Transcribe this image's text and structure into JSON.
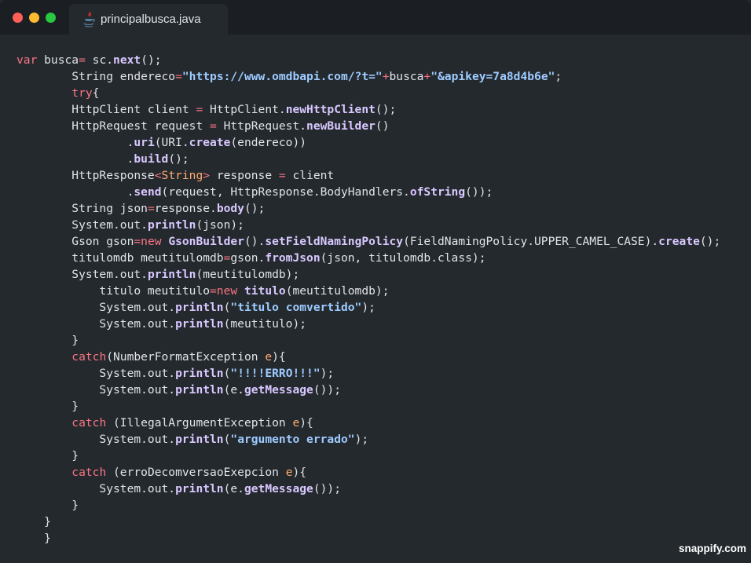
{
  "window": {
    "controls": [
      "close",
      "minimize",
      "maximize"
    ],
    "tab": {
      "title": "principalbusca.java",
      "icon": "java-file-icon"
    },
    "colors": {
      "background": "#24292e",
      "titlebar": "#1b1f23",
      "keyword": "#f97583",
      "method": "#d9c8ff",
      "string": "#9ecbff",
      "param": "#ffab70"
    }
  },
  "code": {
    "lines": [
      [
        [
          "k",
          "var"
        ],
        [
          "t",
          " busca"
        ],
        [
          "k",
          "="
        ],
        [
          "t",
          " sc."
        ],
        [
          "f",
          "next"
        ],
        [
          "t",
          "();"
        ]
      ],
      [
        [
          "t",
          "        String endereco"
        ],
        [
          "k",
          "="
        ],
        [
          "s",
          "\"https://www.omdbapi.com/?t=\""
        ],
        [
          "k",
          "+"
        ],
        [
          "t",
          "busca"
        ],
        [
          "k",
          "+"
        ],
        [
          "s",
          "\"&apikey=7a8d4b6e\""
        ],
        [
          "t",
          ";"
        ]
      ],
      [
        [
          "t",
          "        "
        ],
        [
          "k",
          "try"
        ],
        [
          "t",
          "{"
        ]
      ],
      [
        [
          "t",
          "        HttpClient client "
        ],
        [
          "k",
          "="
        ],
        [
          "t",
          " HttpClient."
        ],
        [
          "f",
          "newHttpClient"
        ],
        [
          "t",
          "();"
        ]
      ],
      [
        [
          "t",
          "        HttpRequest request "
        ],
        [
          "k",
          "="
        ],
        [
          "t",
          " HttpRequest."
        ],
        [
          "f",
          "newBuilder"
        ],
        [
          "t",
          "()"
        ]
      ],
      [
        [
          "t",
          "                ."
        ],
        [
          "f",
          "uri"
        ],
        [
          "t",
          "(URI."
        ],
        [
          "f",
          "create"
        ],
        [
          "t",
          "(endereco))"
        ]
      ],
      [
        [
          "t",
          "                ."
        ],
        [
          "f",
          "build"
        ],
        [
          "t",
          "();"
        ]
      ],
      [
        [
          "t",
          "        HttpResponse"
        ],
        [
          "k",
          "<"
        ],
        [
          "p",
          "String"
        ],
        [
          "k",
          ">"
        ],
        [
          "t",
          " response "
        ],
        [
          "k",
          "="
        ],
        [
          "t",
          " client"
        ]
      ],
      [
        [
          "t",
          "                ."
        ],
        [
          "f",
          "send"
        ],
        [
          "t",
          "(request, HttpResponse.BodyHandlers."
        ],
        [
          "f",
          "ofString"
        ],
        [
          "t",
          "());"
        ]
      ],
      [
        [
          "t",
          "        String json"
        ],
        [
          "k",
          "="
        ],
        [
          "t",
          "response."
        ],
        [
          "f",
          "body"
        ],
        [
          "t",
          "();"
        ]
      ],
      [
        [
          "t",
          "        System.out."
        ],
        [
          "f",
          "println"
        ],
        [
          "t",
          "(json);"
        ]
      ],
      [
        [
          "t",
          "        Gson gson"
        ],
        [
          "k",
          "=new"
        ],
        [
          "t",
          " "
        ],
        [
          "f",
          "GsonBuilder"
        ],
        [
          "t",
          "()."
        ],
        [
          "f",
          "setFieldNamingPolicy"
        ],
        [
          "t",
          "(FieldNamingPolicy.UPPER_CAMEL_CASE)."
        ],
        [
          "f",
          "create"
        ],
        [
          "t",
          "();"
        ]
      ],
      [
        [
          "t",
          "        titulomdb meutitulomdb"
        ],
        [
          "k",
          "="
        ],
        [
          "t",
          "gson."
        ],
        [
          "f",
          "fromJson"
        ],
        [
          "t",
          "(json, titulomdb.class);"
        ]
      ],
      [
        [
          "t",
          "        System.out."
        ],
        [
          "f",
          "println"
        ],
        [
          "t",
          "(meutitulomdb);"
        ]
      ],
      [
        [
          "t",
          "            titulo meutitulo"
        ],
        [
          "k",
          "=new"
        ],
        [
          "t",
          " "
        ],
        [
          "f",
          "titulo"
        ],
        [
          "t",
          "(meutitulomdb);"
        ]
      ],
      [
        [
          "t",
          "            System.out."
        ],
        [
          "f",
          "println"
        ],
        [
          "t",
          "("
        ],
        [
          "s",
          "\"titulo comvertido\""
        ],
        [
          "t",
          ");"
        ]
      ],
      [
        [
          "t",
          "            System.out."
        ],
        [
          "f",
          "println"
        ],
        [
          "t",
          "(meutitulo);"
        ]
      ],
      [
        [
          "t",
          "        }"
        ]
      ],
      [
        [
          "t",
          "        "
        ],
        [
          "k",
          "catch"
        ],
        [
          "t",
          "(NumberFormatException "
        ],
        [
          "p",
          "e"
        ],
        [
          "t",
          "){"
        ]
      ],
      [
        [
          "t",
          "            System.out."
        ],
        [
          "f",
          "println"
        ],
        [
          "t",
          "("
        ],
        [
          "s",
          "\"!!!!ERRO!!!\""
        ],
        [
          "t",
          ");"
        ]
      ],
      [
        [
          "t",
          "            System.out."
        ],
        [
          "f",
          "println"
        ],
        [
          "t",
          "(e."
        ],
        [
          "f",
          "getMessage"
        ],
        [
          "t",
          "());"
        ]
      ],
      [
        [
          "t",
          "        }"
        ]
      ],
      [
        [
          "t",
          "        "
        ],
        [
          "k",
          "catch"
        ],
        [
          "t",
          " (IllegalArgumentException "
        ],
        [
          "p",
          "e"
        ],
        [
          "t",
          "){"
        ]
      ],
      [
        [
          "t",
          "            System.out."
        ],
        [
          "f",
          "println"
        ],
        [
          "t",
          "("
        ],
        [
          "s",
          "\"argumento errado\""
        ],
        [
          "t",
          ");"
        ]
      ],
      [
        [
          "t",
          "        }"
        ]
      ],
      [
        [
          "t",
          "        "
        ],
        [
          "k",
          "catch"
        ],
        [
          "t",
          " (erroDecomversaoExepcion "
        ],
        [
          "p",
          "e"
        ],
        [
          "t",
          "){"
        ]
      ],
      [
        [
          "t",
          "            System.out."
        ],
        [
          "f",
          "println"
        ],
        [
          "t",
          "(e."
        ],
        [
          "f",
          "getMessage"
        ],
        [
          "t",
          "());"
        ]
      ],
      [
        [
          "t",
          "        }"
        ]
      ],
      [
        [
          "t",
          "    }"
        ]
      ],
      [
        [
          "t",
          "    }"
        ]
      ]
    ]
  },
  "watermark": "snappify.com"
}
